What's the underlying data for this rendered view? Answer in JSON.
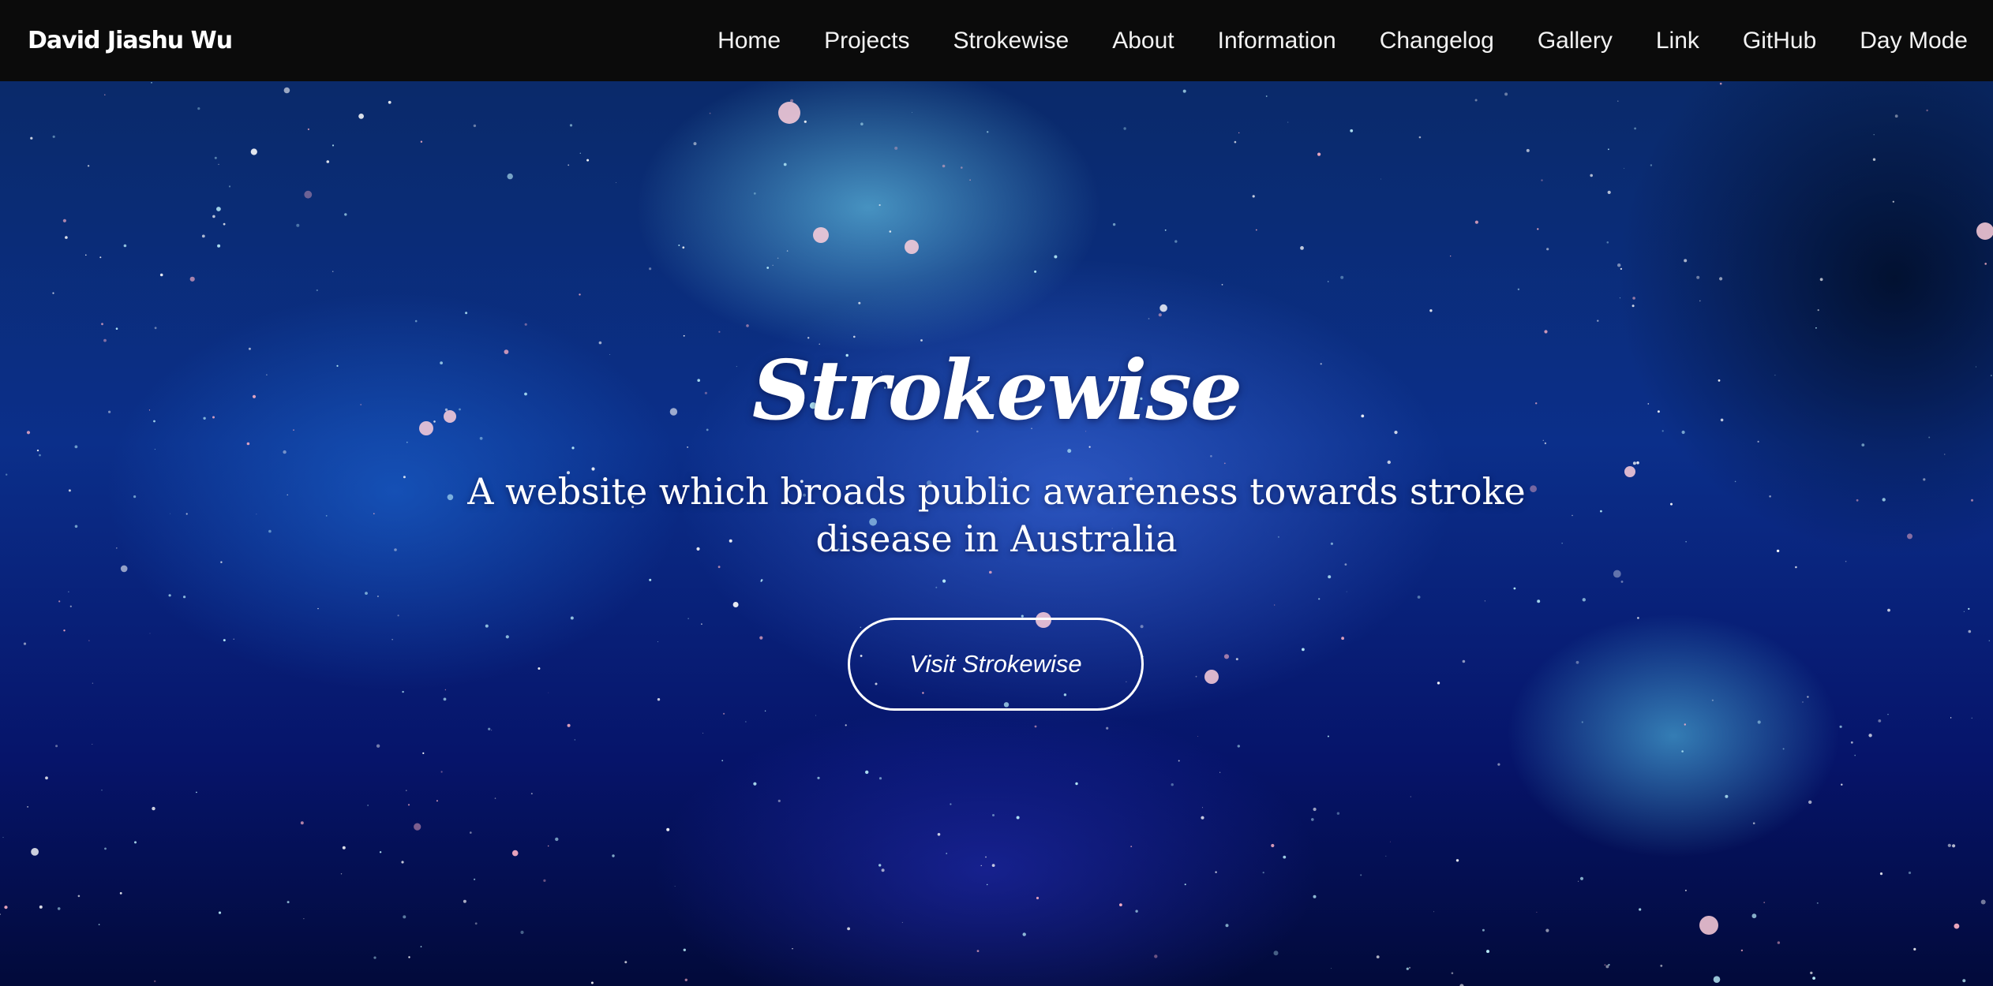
{
  "navbar": {
    "brand": "David Jiashu Wu",
    "links": [
      {
        "label": "Home"
      },
      {
        "label": "Projects"
      },
      {
        "label": "Strokewise"
      },
      {
        "label": "About"
      },
      {
        "label": "Information"
      },
      {
        "label": "Changelog"
      },
      {
        "label": "Gallery"
      },
      {
        "label": "Link"
      },
      {
        "label": "GitHub"
      },
      {
        "label": "Day Mode"
      }
    ]
  },
  "hero": {
    "title": "Strokewise",
    "subtitle": "A website which broads public awareness towards stroke disease in Australia",
    "button_label": "Visit Strokewise"
  },
  "colors": {
    "navbar_bg": "#0b0b0b",
    "text": "#ffffff"
  }
}
